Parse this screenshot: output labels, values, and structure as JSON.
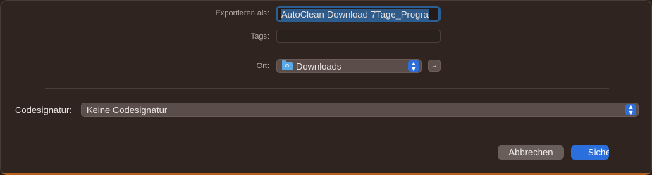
{
  "export": {
    "label": "Exportieren als:",
    "value": "AutoClean-Download-7Tage_Progra"
  },
  "tags": {
    "label": "Tags:",
    "value": ""
  },
  "location": {
    "label": "Ort:",
    "value": "Downloads",
    "icon": "folder-icon"
  },
  "code_signing": {
    "label": "Codesignatur:",
    "value": "Keine Codesignatur"
  },
  "buttons": {
    "cancel": "Abbrechen",
    "save": "Siche"
  },
  "colors": {
    "accent": "#2a6fdc",
    "window_bg": "#2f2420",
    "focus_ring": "#2b5f93"
  }
}
